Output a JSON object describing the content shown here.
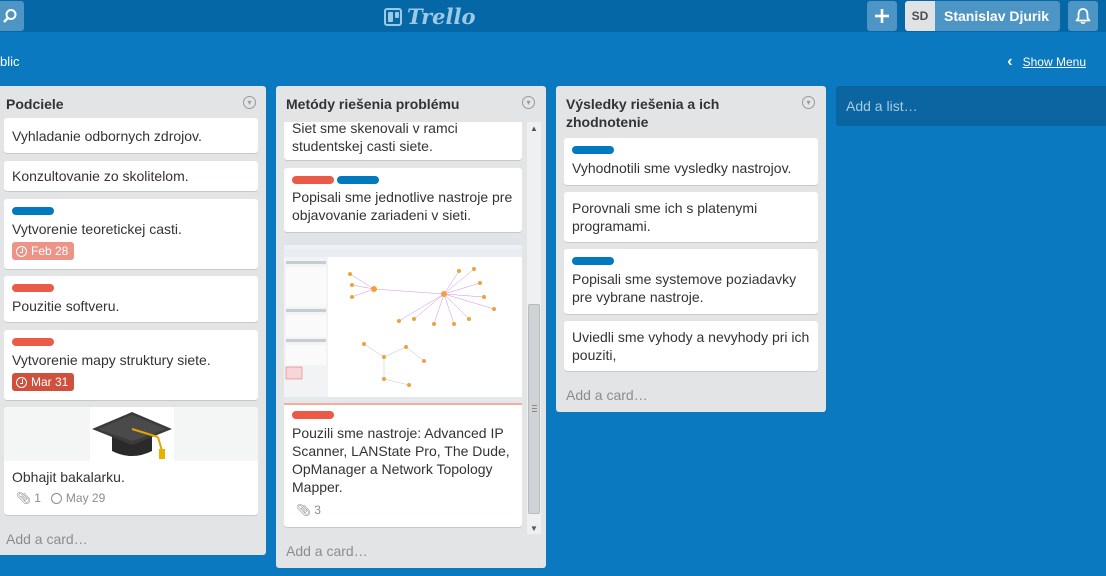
{
  "app": {
    "logo_text": "Trello",
    "user_initials": "SD",
    "user_name": "Stanislav Djurik"
  },
  "board": {
    "title_fragment": "blic",
    "show_menu_label": "Show Menu"
  },
  "lists": [
    {
      "title": "Podciele",
      "add_card": "Add a card…",
      "cards": [
        {
          "text": "Vyhladanie odbornych zdrojov."
        },
        {
          "text": "Konzultovanie zo skolitelom."
        },
        {
          "text": "Vytvorenie teoretickej casti.",
          "labels": [
            "blue"
          ],
          "due": "Feb 28",
          "due_color": "#ec9488"
        },
        {
          "text": "Pouzitie softveru.",
          "labels": [
            "red"
          ]
        },
        {
          "text": "Vytvorenie mapy struktury siete.",
          "labels": [
            "red"
          ],
          "due": "Mar 31",
          "due_color": "#cf513d"
        },
        {
          "text": "Obhajit bakalarku.",
          "cover": "graduation-cap-image",
          "attachments": "1",
          "due": "May 29"
        }
      ]
    },
    {
      "title": "Metódy riešenia problému",
      "add_card": "Add a card…",
      "cards": [
        {
          "text": "Siet sme skenovali v ramci studentskej casti siete."
        },
        {
          "text": "Popisali sme jednotlive nastroje pre objavovanie zariadeni v sieti.",
          "labels": [
            "red",
            "blue"
          ]
        },
        {
          "text": "Pouzili sme nastroje: Advanced IP Scanner, LANState Pro, The Dude, OpManager a Network Topology Mapper.",
          "labels": [
            "red"
          ],
          "cover": "network-topology-screenshot",
          "attachments": "3"
        }
      ]
    },
    {
      "title": "Výsledky riešenia a ich zhodnotenie",
      "add_card": "Add a card…",
      "cards": [
        {
          "text": "Vyhodnotili sme vysledky nastrojov.",
          "labels": [
            "blue"
          ]
        },
        {
          "text": "Porovnali sme ich s platenymi programami."
        },
        {
          "text": "Popisali sme systemove poziadavky pre vybrane nastroje.",
          "labels": [
            "blue"
          ]
        },
        {
          "text": "Uviedli sme vyhody a nevyhody pri ich pouziti,"
        }
      ]
    }
  ],
  "add_list_label": "Add a list…",
  "colors": {
    "board_bg": "#0a79bf",
    "header_bg": "#0567a6",
    "label_blue": "#0079bf",
    "label_red": "#eb5a46"
  }
}
